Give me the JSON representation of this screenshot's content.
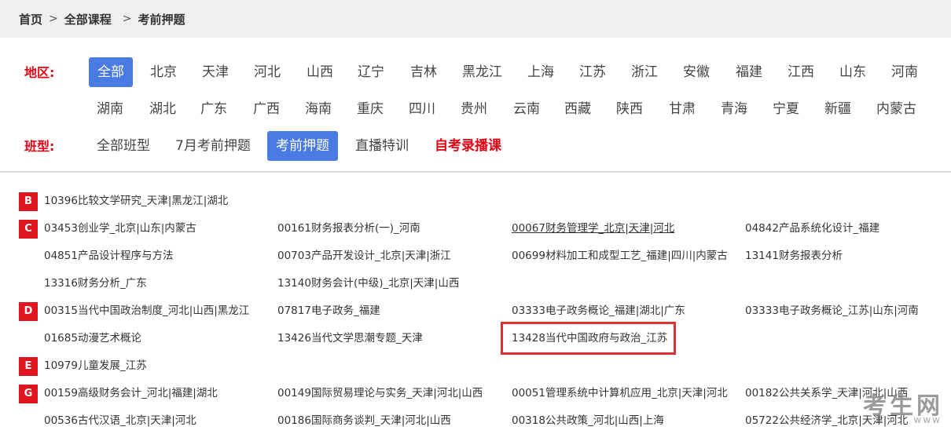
{
  "breadcrumb": {
    "home": "首页",
    "all_courses": "全部课程",
    "current": "考前押题",
    "separator": ">"
  },
  "filters": {
    "region_label": "地区:",
    "class_label": "班型:",
    "regions_row1": [
      "全部",
      "北京",
      "天津",
      "河北",
      "山西",
      "辽宁",
      "吉林",
      "黑龙江",
      "上海",
      "江苏",
      "浙江",
      "安徽",
      "福建",
      "江西",
      "山东",
      "河南"
    ],
    "regions_row2": [
      "湖南",
      "湖北",
      "广东",
      "广西",
      "海南",
      "重庆",
      "四川",
      "贵州",
      "云南",
      "西藏",
      "陕西",
      "甘肃",
      "青海",
      "宁夏",
      "新疆",
      "内蒙古"
    ],
    "classes": [
      "全部班型",
      "7月考前押题",
      "考前押题",
      "直播特训",
      "自考录播课"
    ],
    "active_region": "全部",
    "active_class": "考前押题",
    "highlight_color": "#4a7be5"
  },
  "courses": {
    "B": {
      "letter": "B",
      "items": [
        "10396比较文学研究_天津|黑龙江|湖北"
      ]
    },
    "C": {
      "letter": "C",
      "items": [
        "03453创业学_北京|山东|内蒙古",
        "00161财务报表分析(一)_河南",
        "00067财务管理学_北京|天津|河北",
        "04842产品系统化设计_福建",
        "04851产品设计程序与方法",
        "00703产品开发设计_北京|天津|浙江",
        "00699材料加工和成型工艺_福建|四川|内蒙古",
        "13141财务报表分析",
        "13316财务分析_广东",
        "13140财务会计(中级)_北京|天津|山西"
      ]
    },
    "D": {
      "letter": "D",
      "items": [
        "00315当代中国政治制度_河北|山西|黑龙江",
        "07817电子政务_福建",
        "03333电子政务概论_福建|湖北|广东",
        "03333电子政务概论_江苏|山东|河南",
        "01685动漫艺术概论",
        "13426当代文学思潮专题_天津",
        "13428当代中国政府与政治_江苏"
      ]
    },
    "E": {
      "letter": "E",
      "items": [
        "10979儿童发展_江苏"
      ]
    },
    "G": {
      "letter": "G",
      "items": [
        "00159高级财务会计_河北|福建|湖北",
        "00149国际贸易理论与实务_天津|河北|山西",
        "00051管理系统中计算机应用_北京|天津|河北",
        "00182公共关系学_天津|河北|山西",
        "00536古代汉语_北京|天津|河北",
        "00186国际商务谈判_天津|河北|山西",
        "00318公共政策_河北|山西|上海",
        "05722公共经济学_北京|天津|河北"
      ]
    }
  },
  "watermark": {
    "text": "考生网",
    "sub": "www"
  },
  "colors": {
    "accent_red": "#e60012",
    "letter_badge": "#e0151f",
    "active_blue": "#4a7be5"
  }
}
